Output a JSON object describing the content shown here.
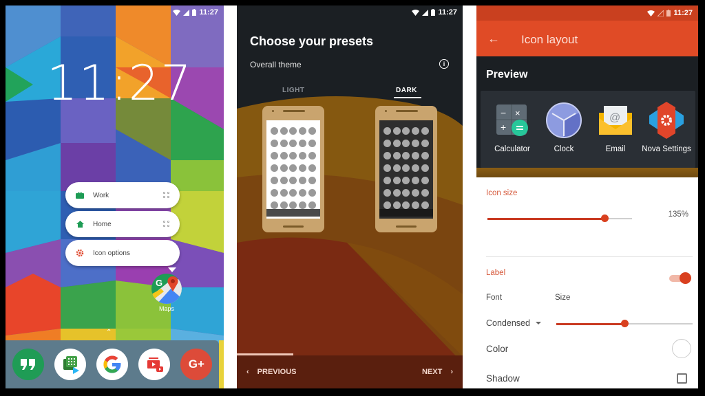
{
  "status_bar": {
    "time": "11:27"
  },
  "panel_home": {
    "clock": "11:27",
    "shortcut_menu": [
      {
        "label": "Work",
        "icon": "briefcase-icon",
        "color": "#1e9c55",
        "draggable": true
      },
      {
        "label": "Home",
        "icon": "home-icon",
        "color": "#1e9c55",
        "draggable": true
      },
      {
        "label": "Icon options",
        "icon": "gear-icon",
        "color": "#e0452a",
        "draggable": false
      }
    ],
    "app": {
      "label": "Maps",
      "icon": "google-maps-icon"
    },
    "dock": [
      {
        "name": "Hangouts",
        "icon": "hangouts-icon"
      },
      {
        "name": "Play Store apps",
        "icon": "play-apps-icon"
      },
      {
        "name": "Google",
        "icon": "google-icon"
      },
      {
        "name": "YouTube",
        "icon": "youtube-icon"
      },
      {
        "name": "Google+",
        "icon": "google-plus-icon",
        "label": "G+"
      }
    ]
  },
  "panel_presets": {
    "title": "Choose your presets",
    "subtitle": "Overall theme",
    "info_icon": "info-icon",
    "tabs": [
      {
        "label": "LIGHT",
        "selected": false
      },
      {
        "label": "DARK",
        "selected": true
      }
    ],
    "footer": {
      "previous_label": "PREVIOUS",
      "next_label": "NEXT"
    },
    "progress_fraction": 0.25
  },
  "panel_icon_layout": {
    "title": "Icon layout",
    "preview_title": "Preview",
    "preview_apps": [
      {
        "label": "Calculator",
        "icon": "calculator-icon"
      },
      {
        "label": "Clock",
        "icon": "clock-icon"
      },
      {
        "label": "Email",
        "icon": "email-icon"
      },
      {
        "label": "Nova Settings",
        "icon": "nova-settings-icon"
      }
    ],
    "icon_size": {
      "label": "Icon size",
      "value": "135%",
      "fraction": 0.81
    },
    "label_section": {
      "label": "Label",
      "enabled": true
    },
    "font": {
      "label": "Font",
      "value": "Condensed"
    },
    "size": {
      "label": "Size",
      "fraction": 0.5
    },
    "color": {
      "label": "Color",
      "value": "#ffffff"
    },
    "shadow": {
      "label": "Shadow",
      "checked": false
    }
  },
  "colors": {
    "accent": "#e04b26",
    "dark_bg": "#1b1f23",
    "toggle_on": "#d9401f"
  }
}
